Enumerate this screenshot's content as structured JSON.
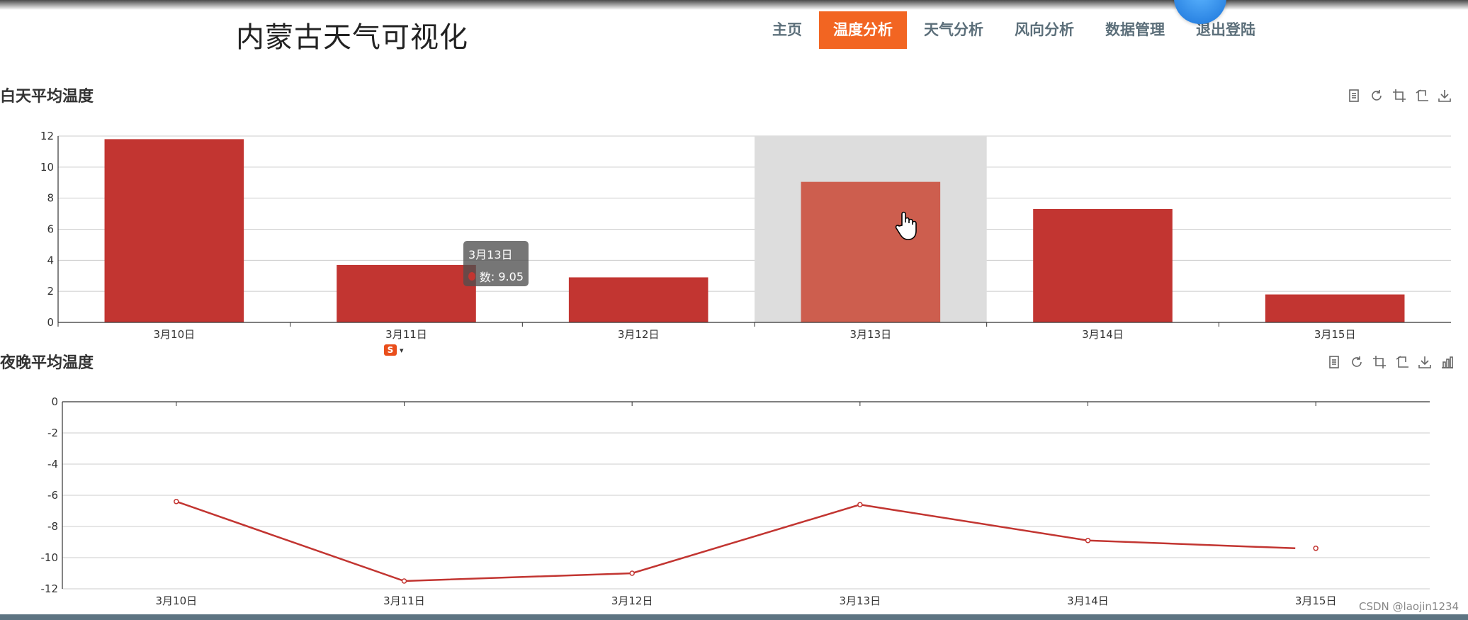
{
  "site": {
    "title": "内蒙古天气可视化"
  },
  "nav": {
    "items": [
      {
        "label": "主页",
        "active": false
      },
      {
        "label": "温度分析",
        "active": true
      },
      {
        "label": "天气分析",
        "active": false
      },
      {
        "label": "风向分析",
        "active": false
      },
      {
        "label": "数据管理",
        "active": false
      },
      {
        "label": "退出登陆",
        "active": false
      }
    ]
  },
  "tooltip": {
    "title": "3月13日",
    "series_label": "数",
    "value": "9.05"
  },
  "watermark": "CSDN @laojin1234",
  "colors": {
    "accent": "#f26522",
    "series": "#c23531",
    "highlight_band": "#dddddd"
  },
  "toolbox_icons": [
    "data-view-icon",
    "restore-icon",
    "zoom-icon",
    "zoom-reset-icon",
    "save-image-icon",
    "bar-chart-icon"
  ],
  "chart_data": [
    {
      "type": "bar",
      "title": "白天平均温度",
      "categories": [
        "3月10日",
        "3月11日",
        "3月12日",
        "3月13日",
        "3月14日",
        "3月15日"
      ],
      "series": [
        {
          "name": "数",
          "values": [
            11.8,
            3.7,
            2.9,
            9.05,
            7.3,
            1.8
          ]
        }
      ],
      "ylim": [
        0,
        12
      ],
      "yticks": [
        0,
        2,
        4,
        6,
        8,
        10,
        12
      ],
      "grid": true,
      "highlighted_category": "3月13日"
    },
    {
      "type": "line",
      "title": "夜晚平均温度",
      "categories": [
        "3月10日",
        "3月11日",
        "3月12日",
        "3月13日",
        "3月14日",
        "3月15日"
      ],
      "series": [
        {
          "name": "数",
          "values": [
            -6.4,
            -11.5,
            -11.0,
            -6.6,
            -8.9,
            -9.4
          ]
        }
      ],
      "ylim": [
        -12,
        0
      ],
      "yticks": [
        0,
        -2,
        -4,
        -6,
        -8,
        -10,
        -12
      ],
      "grid": true
    }
  ]
}
